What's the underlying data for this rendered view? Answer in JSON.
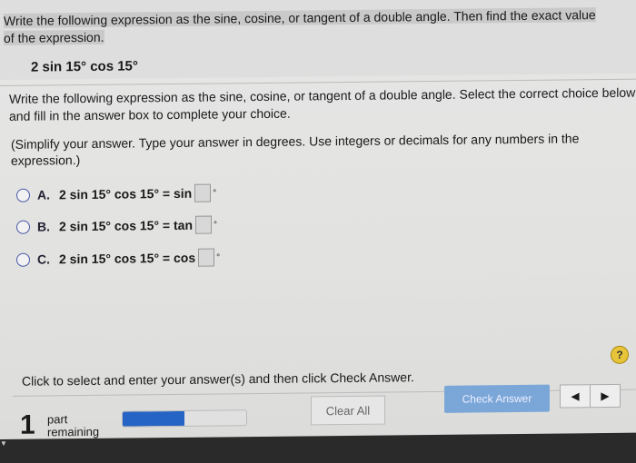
{
  "question": {
    "line1": "Write the following expression as the sine, cosine, or tangent of a double angle. Then find the exact value",
    "line2": "of the expression.",
    "expression": "2 sin 15° cos 15°"
  },
  "instruction": "Write the following expression as the sine, cosine, or tangent of a double angle. Select the correct choice below and fill in the answer box to complete your choice.",
  "simplify": "(Simplify your answer. Type your answer in degrees. Use integers or decimals for any numbers in the expression.)",
  "options": [
    {
      "letter": "A.",
      "text": "2 sin 15° cos 15° = sin",
      "unit": "°"
    },
    {
      "letter": "B.",
      "text": "2 sin 15° cos 15° = tan",
      "unit": "°"
    },
    {
      "letter": "C.",
      "text": "2 sin 15° cos 15° = cos",
      "unit": "°"
    }
  ],
  "help_label": "?",
  "footer": {
    "hint": "Click to select and enter your answer(s) and then click Check Answer.",
    "parts_count": "1",
    "parts_label_1": "part",
    "parts_label_2": "remaining",
    "progress_percent": 50,
    "progress_color": "#2563c4",
    "clear_all": "Clear All",
    "check_answer": "Check Answer",
    "prev": "◀",
    "next": "▶"
  }
}
